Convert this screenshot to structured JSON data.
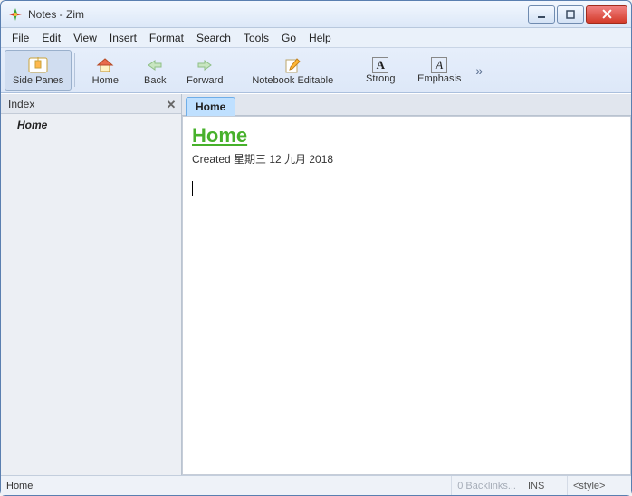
{
  "window": {
    "title": "Notes - Zim"
  },
  "menu": {
    "file": "File",
    "edit": "Edit",
    "view": "View",
    "insert": "Insert",
    "format": "Format",
    "search": "Search",
    "tools": "Tools",
    "go": "Go",
    "help": "Help"
  },
  "toolbar": {
    "side_panes": "Side Panes",
    "home": "Home",
    "back": "Back",
    "forward": "Forward",
    "notebook_editable": "Notebook Editable",
    "strong": "Strong",
    "strong_glyph": "A",
    "emphasis": "Emphasis",
    "emphasis_glyph": "A"
  },
  "side": {
    "title": "Index",
    "items": [
      {
        "label": "Home"
      }
    ]
  },
  "tabs": [
    {
      "label": "Home"
    }
  ],
  "page": {
    "heading": "Home",
    "created": "Created 星期三 12 九月 2018"
  },
  "status": {
    "path": "Home",
    "backlinks": "0 Backlinks...",
    "ins": "INS",
    "style": "<style>"
  }
}
